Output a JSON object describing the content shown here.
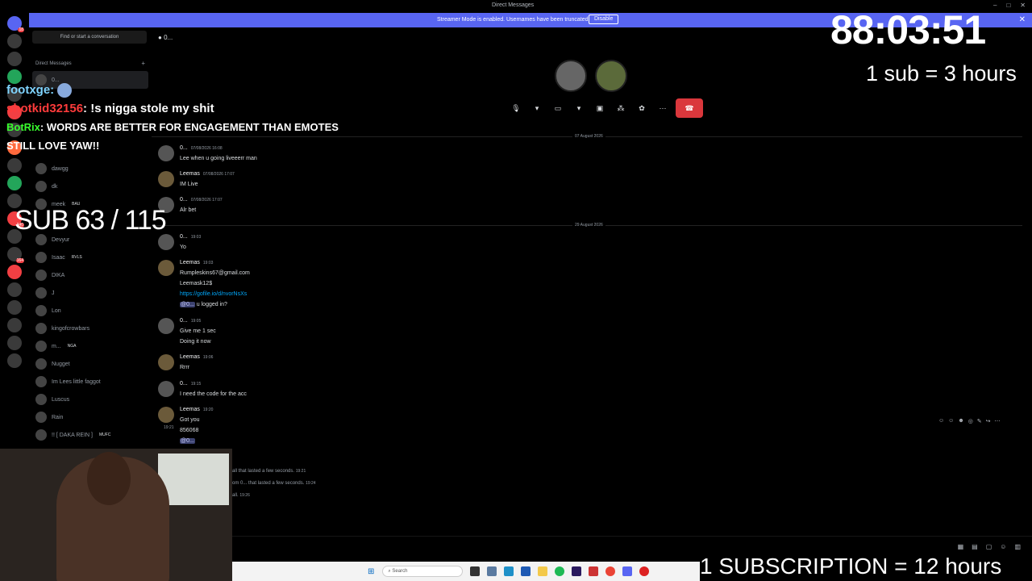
{
  "titlebar": {
    "title": "Direct Messages"
  },
  "banner": {
    "message": "Streamer Mode is enabled. Usernames have been truncated.",
    "disable": "Disable"
  },
  "sidebar": {
    "search": "Find or start a conversation",
    "header": "Direct Messages",
    "items": [
      {
        "name": "0..."
      },
      {
        "name": "dawgg"
      },
      {
        "name": "dk"
      },
      {
        "name": "meek",
        "tag": "BAU"
      },
      {
        "name": "Devyur"
      },
      {
        "name": "Isaac",
        "tag": "RVLS"
      },
      {
        "name": "DIKA"
      },
      {
        "name": "J"
      },
      {
        "name": "Lon"
      },
      {
        "name": "kingofcrowbars"
      },
      {
        "name": "m...",
        "tag": "NGA"
      },
      {
        "name": "Nugget"
      },
      {
        "name": "Im Lees little faggot"
      },
      {
        "name": "Luscus"
      },
      {
        "name": "Rain"
      },
      {
        "name": "!! [ DAKA REIN ]",
        "tag": "MUFC"
      }
    ]
  },
  "channel": {
    "name": "0..."
  },
  "dates": {
    "d1": "07 August 2026",
    "d2": "29 August 2026"
  },
  "messages": [
    {
      "author": "0...",
      "time": "07/08/2026 16:08",
      "lines": [
        "Lee when u going liveeerr man"
      ]
    },
    {
      "author": "Leemas",
      "time": "07/08/2026 17:07",
      "lines": [
        "IM Live"
      ]
    },
    {
      "author": "0...",
      "time": "07/08/2026 17:07",
      "lines": [
        "Alr bet"
      ]
    },
    {
      "author": "0...",
      "time": "19:03",
      "lines": [
        "Yo"
      ]
    },
    {
      "author": "Leemas",
      "time": "19:03",
      "lines": [
        "Rumpleskins67@gmail.com",
        "Leemask12$"
      ],
      "link": "https://gofile.io/d/nvorNsXs",
      "mention": "@0...",
      "mention_tail": " u logged in?"
    },
    {
      "author": "0...",
      "time": "19:05",
      "lines": [
        "Give me 1 sec",
        "Doing it now"
      ]
    },
    {
      "author": "Leemas",
      "time": "19:06",
      "lines": [
        "Rrrr"
      ]
    },
    {
      "author": "0...",
      "time": "19:15",
      "lines": [
        "I need the code for the acc"
      ]
    },
    {
      "author": "Leemas",
      "time": "19:20",
      "lines": [
        "Got you",
        "856068"
      ],
      "mention": "@0...",
      "timestamp2": "19:21"
    }
  ],
  "call_log": [
    {
      "text": "all that lasted a few seconds.",
      "time": "19:21"
    },
    {
      "text": "om 0... that lasted a few seconds.",
      "time": "19:24"
    },
    {
      "text": "all.",
      "time": "19:26"
    }
  ],
  "taskbar": {
    "search": "Search"
  },
  "overlay": {
    "timer": "88:03:51",
    "rate": "1 sub = 3 hours",
    "sub_goal": "SUB 63 / 115",
    "bottom": "1 SUBSCRIPTION = 12 hours"
  },
  "stream_chat": [
    {
      "user": "footxge:",
      "text": ""
    },
    {
      "user": "shotkid32156",
      "text": ": !s nigga stole my shit"
    },
    {
      "user": "BotRix",
      "text": ": WORDS ARE BETTER FOR ENGAGEMENT THAN EMOTES"
    },
    {
      "user": "",
      "text": "STILL LOVE YAW!!"
    }
  ],
  "colors": {
    "accent": "#5865f2",
    "hangup": "#da373c",
    "link": "#00a8fc"
  }
}
